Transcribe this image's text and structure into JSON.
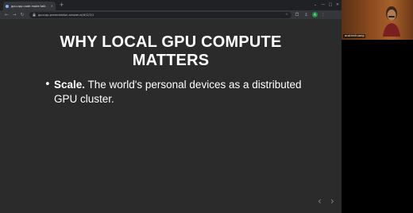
{
  "browser": {
    "tab_title": "gpu.cpp code mode talk",
    "tab_close": "×",
    "new_tab": "+",
    "window_controls": [
      "⌄",
      "—",
      "□",
      "✕"
    ],
    "url": "gpucpp-presentation.answer.ai/#/2/2/1",
    "nav": {
      "back": "←",
      "forward": "→",
      "reload": "↻"
    },
    "profile_initial": "A",
    "icons": [
      "lock-icon",
      "star-icon",
      "extensions-icon",
      "menu-icon"
    ]
  },
  "slide": {
    "title_line1": "WHY LOCAL GPU COMPUTE",
    "title_line2": "MATTERS",
    "bullet_marker": "•",
    "bullet_strong": "Scale.",
    "bullet_text": " The world's personal devices as a distributed GPU cluster.",
    "prev_arrow": "‹",
    "next_arrow": "›"
  },
  "participant": {
    "name": "austinvhuang"
  },
  "colors": {
    "slide_bg": "#2b2b2b",
    "chrome_bg": "#202124",
    "toolbar_bg": "#35363a",
    "text": "#ffffff"
  }
}
